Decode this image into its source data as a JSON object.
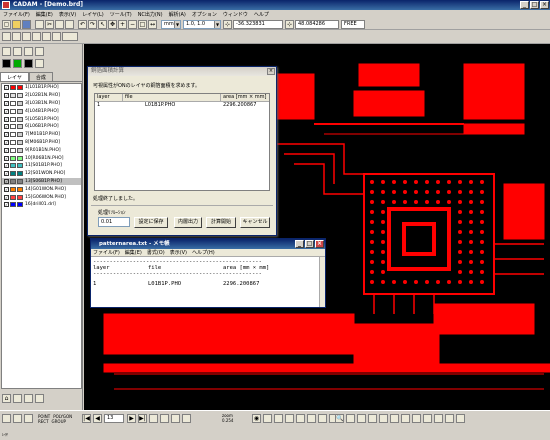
{
  "app": {
    "title": "CADAM - [Demo.brd]",
    "window_buttons": [
      "_",
      "□",
      "×"
    ]
  },
  "menu": [
    "ファイル(F)",
    "編集(E)",
    "表示(V)",
    "レイヤ(L)",
    "ツール(T)",
    "NC出力(N)",
    "解析(A)",
    "オプション",
    "ウィンドウ",
    "ヘルプ"
  ],
  "toolbar2": {
    "unit": "mm",
    "grid": "1.0, 1.0",
    "coord_x": "-36.323831",
    "coord_y": "48.084286",
    "mode": "FREE"
  },
  "left_panel": {
    "tabs": [
      "レイヤ",
      "合成"
    ],
    "layers": [
      {
        "name": "1[L01B1P.PHO]",
        "color": "#ff0000",
        "color2": "#ff0000",
        "checked": true
      },
      {
        "name": "2[L02B1N.PHO]",
        "color": "#e0e0e0",
        "color2": "#e0e0e0",
        "checked": true
      },
      {
        "name": "3[L03B1N.PHO]",
        "color": "#ffffff",
        "color2": "#d0d0d0",
        "checked": true
      },
      {
        "name": "4[L04B1P.PHO]",
        "color": "#ffffff",
        "color2": "#d0d0d0",
        "checked": true
      },
      {
        "name": "5[L05B1P.PHO]",
        "color": "#ffffff",
        "color2": "#d0d0d0",
        "checked": true
      },
      {
        "name": "6[L06B1P.PHO]",
        "color": "#ffffff",
        "color2": "#d0d0d0",
        "checked": true
      },
      {
        "name": "7[M01B1P.PHO]",
        "color": "#ffffff",
        "color2": "#d0d0d0",
        "checked": true
      },
      {
        "name": "8[M06B1P.PHO]",
        "color": "#ffffff",
        "color2": "#d0d0d0",
        "checked": true
      },
      {
        "name": "9[R01B1N.PHO]",
        "color": "#ffffff",
        "color2": "#d0d0d0",
        "checked": true
      },
      {
        "name": "10[R06B1N.PHO]",
        "color": "#80ff80",
        "color2": "#80ff80",
        "checked": true
      },
      {
        "name": "11[S01B1P.PHO]",
        "color": "#40c0c0",
        "color2": "#40c0c0",
        "checked": true
      },
      {
        "name": "12[S01WON.PHO]",
        "color": "#008080",
        "color2": "#008080",
        "checked": true
      },
      {
        "name": "13[S06B1P.PHO]",
        "color": "#808080",
        "color2": "#808080",
        "checked": true
      },
      {
        "name": "14[G01WON.PHO]",
        "color": "#ff8000",
        "color2": "#ff8000",
        "checked": true
      },
      {
        "name": "15[G06WON.PHO]",
        "color": "#ff4040",
        "color2": "#ff4040",
        "checked": true
      },
      {
        "name": "16[drill01.drl]",
        "color": "#0000ff",
        "color2": "#0000ff",
        "checked": true
      }
    ]
  },
  "dialog": {
    "title": "銅箔面積計算",
    "instruction": "可視属性がONのレイヤの銅箔面積を求めます。",
    "headers": [
      "layer",
      "file",
      "area [mm × mm]"
    ],
    "rows": [
      {
        "layer": "1",
        "file": "L01B1P.PHO",
        "area": "2296.200867"
      }
    ],
    "status": "処理終了しました。",
    "resolution_label": "処理ﾘｿﾙｰｼｮﾝ",
    "resolution_value": "0.01",
    "buttons": {
      "save": "設定に保存",
      "output": "内層出力",
      "start": "計算開始",
      "cancel": "キャンセル"
    }
  },
  "notepad": {
    "title": "patternarea.txt - メモ帳",
    "menu": [
      "ファイル(F)",
      "編集(E)",
      "書式(O)",
      "表示(V)",
      "ヘルプ(H)"
    ],
    "separator": "---------------------------------------------------",
    "header": {
      "layer": "layer",
      "file": "file",
      "area": "area [mm × mm]"
    },
    "row": {
      "layer": "1",
      "file": "L01B1P.PHO",
      "area": "2296.200867"
    }
  },
  "statusbar": {
    "page": "13",
    "zoom_label": "zoom",
    "zoom_value": "0.254",
    "radio_options": [
      "POINT",
      "POLYGON",
      "RECT",
      "GROUP"
    ],
    "bottom_left": "ﾚｲﾔ"
  },
  "colors": {
    "copper": "#ff0000",
    "canvas_bg": "#000000",
    "title_bar": "#0a246a",
    "selected_row": "#c0c0c0"
  }
}
